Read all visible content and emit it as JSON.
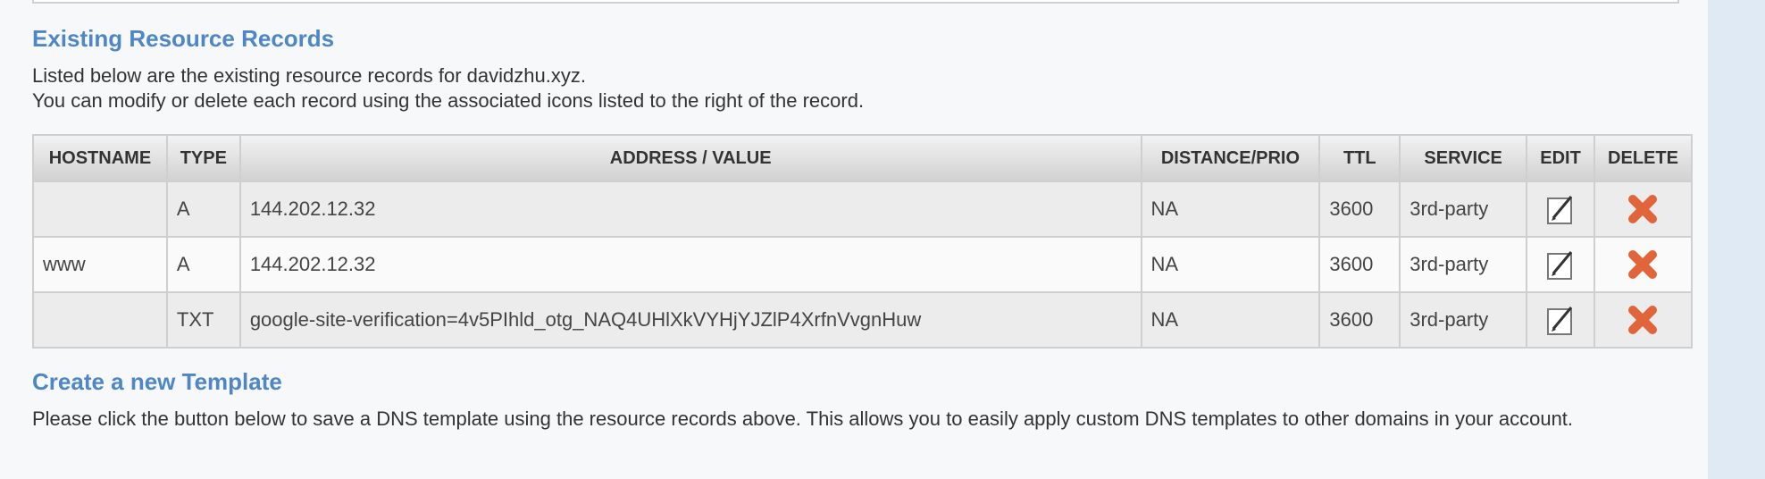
{
  "existing": {
    "title": "Existing Resource Records",
    "line1": "Listed below are the existing resource records for davidzhu.xyz.",
    "line2": "You can modify or delete each record using the associated icons listed to the right of the record."
  },
  "table": {
    "headers": {
      "hostname": "HOSTNAME",
      "type": "TYPE",
      "address": "ADDRESS / VALUE",
      "distance": "DISTANCE/PRIO",
      "ttl": "TTL",
      "service": "SERVICE",
      "edit": "EDIT",
      "delete": "DELETE"
    },
    "rows": [
      {
        "hostname": "",
        "type": "A",
        "address": "144.202.12.32",
        "distance": "NA",
        "ttl": "3600",
        "service": "3rd-party"
      },
      {
        "hostname": "www",
        "type": "A",
        "address": "144.202.12.32",
        "distance": "NA",
        "ttl": "3600",
        "service": "3rd-party"
      },
      {
        "hostname": "",
        "type": "TXT",
        "address": "google-site-verification=4v5PIhld_otg_NAQ4UHlXkVYHjYJZlP4XrfnVvgnHuw",
        "distance": "NA",
        "ttl": "3600",
        "service": "3rd-party"
      }
    ],
    "icons": {
      "edit": "edit-pencil-icon",
      "delete": "delete-x-icon"
    }
  },
  "template": {
    "title": "Create a new Template",
    "body": "Please click the button below to save a DNS template using the resource records above. This allows you to easily apply custom DNS templates to other domains in your account."
  },
  "colors": {
    "heading": "#4f86c6",
    "delete_icon": "#e2643a",
    "side_panel": "#dfeaf5"
  }
}
